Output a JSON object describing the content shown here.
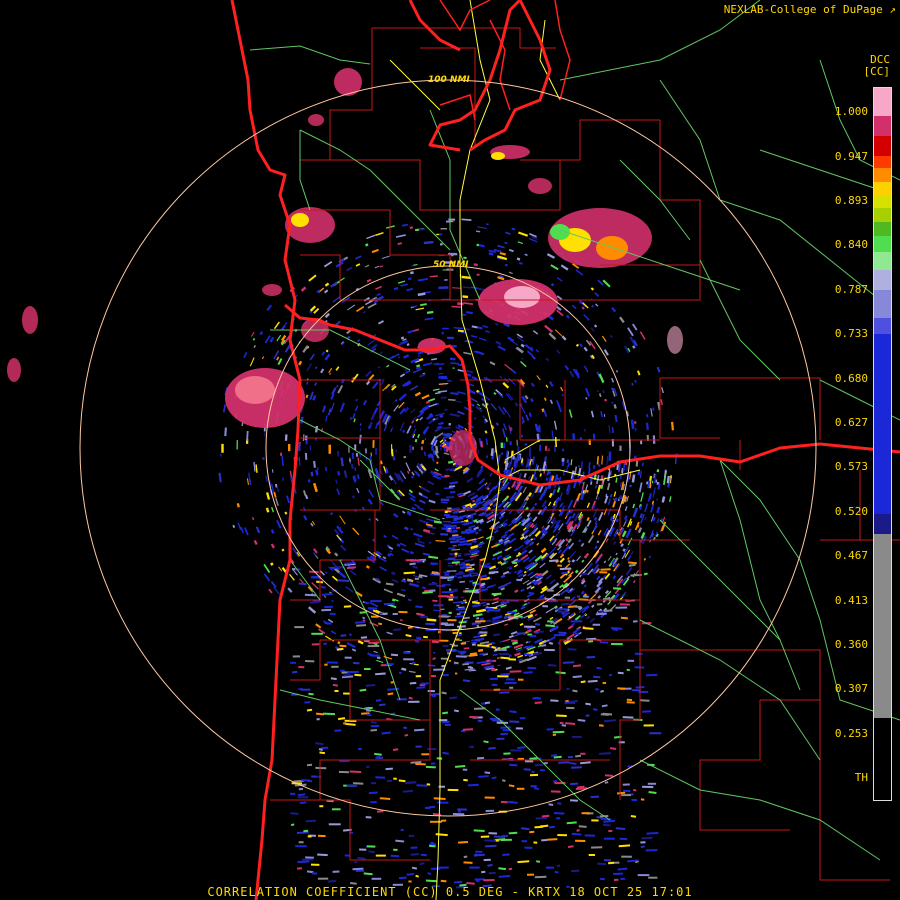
{
  "header": {
    "credit": "NEXLAB-College of DuPage"
  },
  "product": {
    "name": "CORRELATION COEFFICIENT (CC)",
    "elevation": "0.5 DEG",
    "radar": "KRTX",
    "datetime": "18 OCT 25 17:01",
    "footer_text": "CORRELATION COEFFICIENT (CC) 0.5 DEG - KRTX 18 OCT 25 17:01"
  },
  "legend": {
    "title_line1": "DCC",
    "title_line2": "[CC]",
    "ticks": [
      "1.000",
      "0.947",
      "0.893",
      "0.840",
      "0.787",
      "0.733",
      "0.680",
      "0.627",
      "0.573",
      "0.520",
      "0.467",
      "0.413",
      "0.360",
      "0.307",
      "0.253",
      "TH"
    ],
    "colors": {
      "pink_high": "#f7a8c8",
      "magenta": "#d2306a",
      "red": "#d40000",
      "orange": "#ff8c00",
      "yellow": "#ffe000",
      "green": "#50dd50",
      "light_purple": "#9a9ad8",
      "blue": "#1a28d8",
      "navy": "#1a1a88",
      "gray": "#8a8a8a",
      "black": "#000000"
    }
  },
  "range_rings": [
    {
      "label": "50 NMI"
    },
    {
      "label": "100 NMI"
    }
  ],
  "map_colors": {
    "county_lines": "#c81818",
    "state_lines": "#ff2020",
    "highways": "#ffff40",
    "rivers_roads": "#80e080",
    "range_ring": "#ffc8a0"
  }
}
